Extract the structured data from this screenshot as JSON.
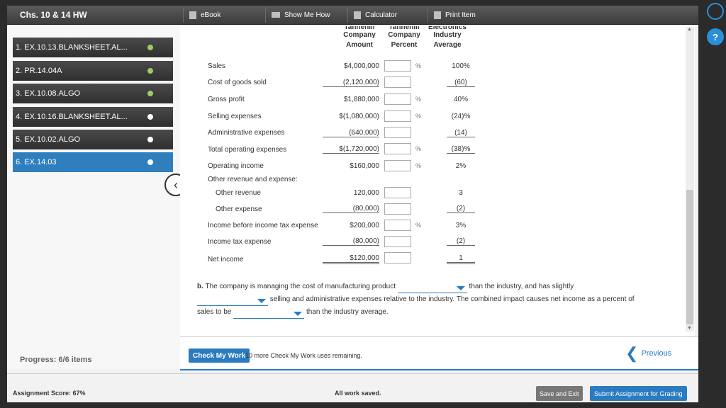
{
  "header": {
    "title": "Chs. 10 & 14 HW",
    "toolbar": [
      {
        "label": "eBook",
        "icon": "book-icon"
      },
      {
        "label": "Show Me How",
        "icon": "video-icon"
      },
      {
        "label": "Calculator",
        "icon": "calculator-icon"
      },
      {
        "label": "Print Item",
        "icon": "print-icon"
      }
    ]
  },
  "sidebar": {
    "items": [
      {
        "label": "1. EX.10.13.BLANKSHEET.AL...",
        "status": "done"
      },
      {
        "label": "2. PR.14.04A",
        "status": "done"
      },
      {
        "label": "3. EX.10.08.ALGO",
        "status": "done"
      },
      {
        "label": "4. EX.10.16.BLANKSHEET.AL...",
        "status": "open"
      },
      {
        "label": "5. EX.10.02.ALGO",
        "status": "open"
      },
      {
        "label": "6. EX.14.03",
        "status": "active"
      }
    ],
    "progress": "Progress: 6/6 items"
  },
  "table": {
    "headers": {
      "company1_line1": "Tannehill",
      "company1_line2": "Company",
      "company1_line3": "Amount",
      "company2_line1": "Tannehill",
      "company2_line2": "Company",
      "company2_line3": "Percent",
      "industry_line1": "Electronics",
      "industry_line2": "Industry",
      "industry_line3": "Average"
    },
    "rows": [
      {
        "label": "Sales",
        "amount": "$4,000,000",
        "pct": "%",
        "industry": "100%"
      },
      {
        "label": "Cost of goods sold",
        "amount": "(2,120,000)",
        "pct": "",
        "industry": "(60)"
      },
      {
        "label": "Gross profit",
        "amount": "$1,880,000",
        "pct": "%",
        "industry": "40%"
      },
      {
        "label": "Selling expenses",
        "amount": "$(1,080,000)",
        "pct": "%",
        "industry": "(24)%"
      },
      {
        "label": "Administrative expenses",
        "amount": "(640,000)",
        "pct": "",
        "industry": "(14)"
      },
      {
        "label": "Total operating expenses",
        "amount": "$(1,720,000)",
        "pct": "%",
        "industry": "(38)%"
      },
      {
        "label": "Operating income",
        "amount": "$160,000",
        "pct": "%",
        "industry": "2%"
      },
      {
        "label": "Other revenue and expense:",
        "amount": "",
        "pct": "",
        "industry": ""
      },
      {
        "label": "Other revenue",
        "amount": "120,000",
        "pct": "",
        "industry": "3"
      },
      {
        "label": "Other expense",
        "amount": "(80,000)",
        "pct": "",
        "industry": "(2)"
      },
      {
        "label": "Income before income tax expense",
        "amount": "$200,000",
        "pct": "%",
        "industry": "3%"
      },
      {
        "label": "Income tax expense",
        "amount": "(80,000)",
        "pct": "",
        "industry": "(2)"
      },
      {
        "label": "Net income",
        "amount": "$120,000",
        "pct": "",
        "industry": "1"
      }
    ]
  },
  "part_b": {
    "prefix": "b.",
    "text1": "The company is managing the cost of manufacturing product",
    "text2": "than the industry, and has slightly",
    "text3": "selling and administrative expenses relative to the industry. The combined impact causes net income as a percent of",
    "text4": "sales to be",
    "text5": "than the industry average."
  },
  "check": {
    "button": "Check My Work",
    "info": "10 more Check My Work uses remaining.",
    "previous": "Previous"
  },
  "footer": {
    "score": "Assignment Score: 67%",
    "saved": "All work saved.",
    "save_exit": "Save and Exit",
    "submit": "Submit Assignment for Grading"
  },
  "colors": {
    "accent": "#2a7bc0",
    "done_dot": "#9ccc65",
    "dark_bar": "#3c3c3c"
  }
}
